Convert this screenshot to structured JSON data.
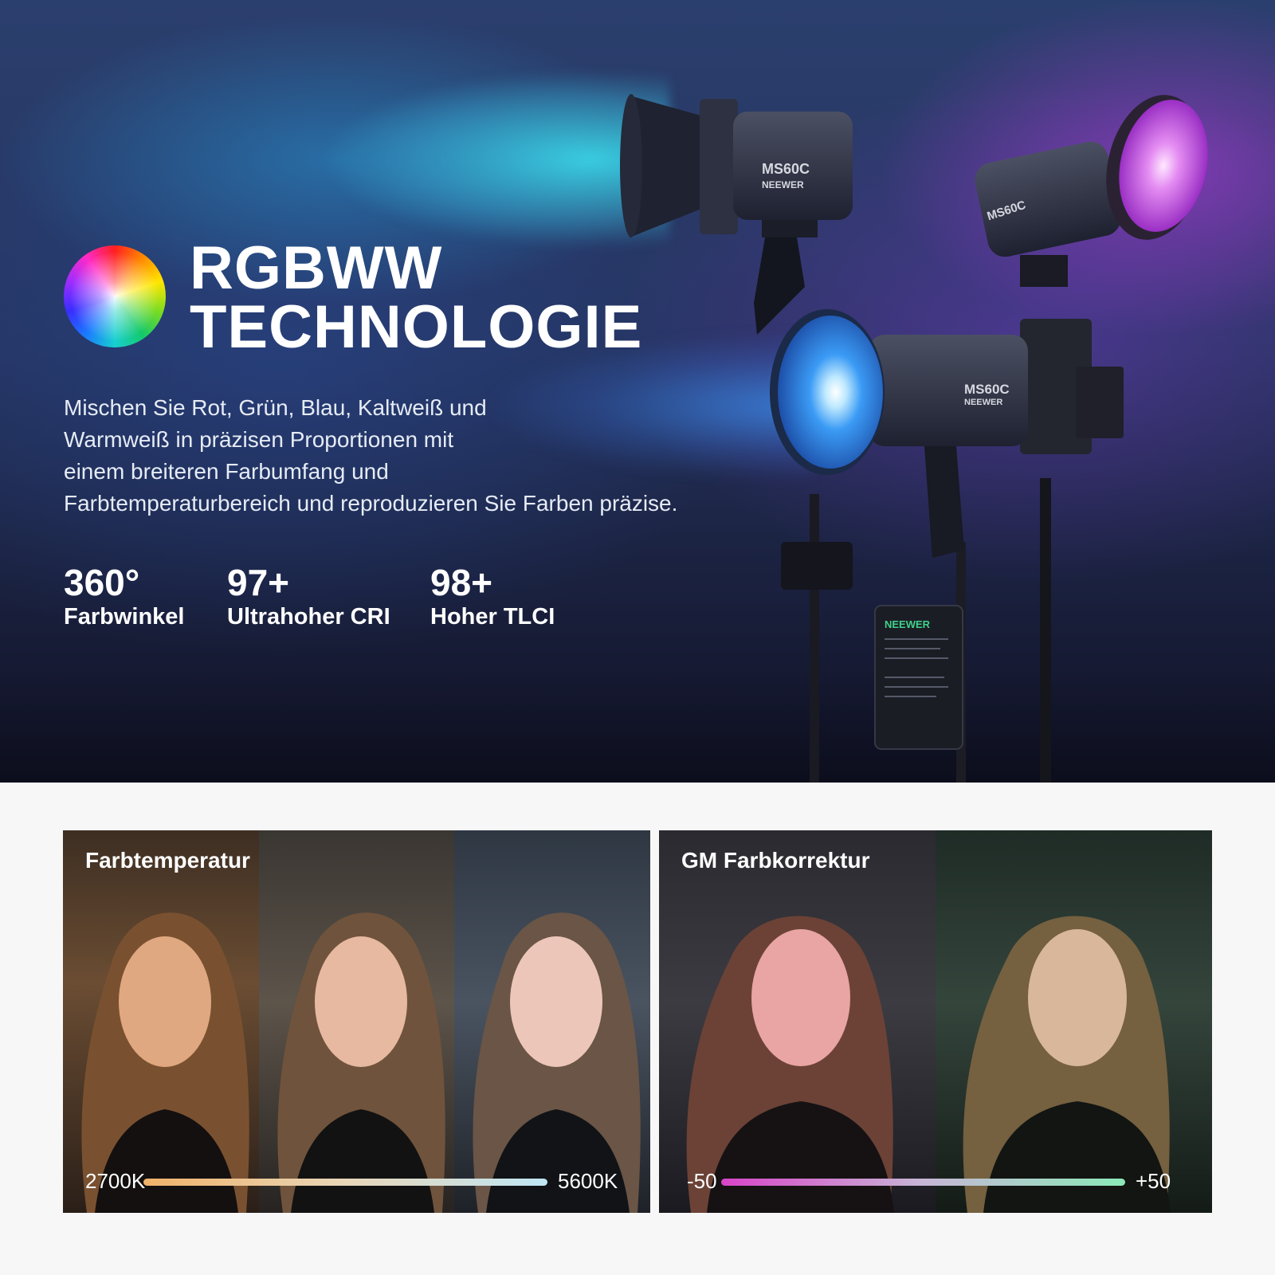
{
  "hero": {
    "headline_line1": "RGBWW",
    "headline_line2": "TECHNOLOGIE",
    "description_lines": [
      "Mischen Sie Rot, Grün, Blau, Kaltweiß und",
      "Warmweiß in präzisen Proportionen mit",
      "einem breiteren Farbumfang und",
      "Farbtemperaturbereich und reproduzieren Sie Farben präzise."
    ],
    "stats": [
      {
        "value": "360°",
        "label": "Farbwinkel"
      },
      {
        "value": "97+",
        "label": "Ultrahoher CRI"
      },
      {
        "value": "98+",
        "label": "Hoher TLCI"
      }
    ],
    "light_brand": "NEEWER",
    "light_model": "MS60C",
    "battery_brand": "NEEWER"
  },
  "panels": {
    "color_temperature": {
      "title": "Farbtemperatur",
      "scale_min": "2700K",
      "scale_max": "5600K",
      "gradient_colors": [
        "#f0b26a",
        "#e8d6b8",
        "#bfe6f5"
      ]
    },
    "gm_correction": {
      "title": "GM Farbkorrektur",
      "scale_min": "-50",
      "scale_max": "+50",
      "gradient_colors": [
        "#d845c8",
        "#c7b6d6",
        "#8be9b8"
      ]
    }
  }
}
